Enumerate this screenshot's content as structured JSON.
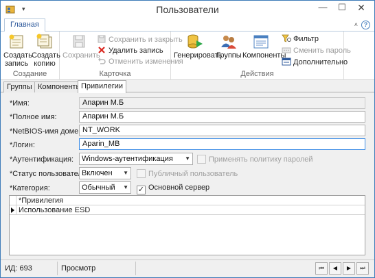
{
  "window": {
    "title": "Пользователи",
    "min_glyph": "—",
    "max_glyph": "☐",
    "close_glyph": "✕",
    "qat_glyph": "▾"
  },
  "ribbon": {
    "tab_label": "Главная",
    "collapse_glyph": "˄",
    "help_glyph": "?",
    "groups": {
      "create": {
        "label": "Создание",
        "create_record": "Создать запись",
        "create_copy": "Создать копию"
      },
      "card": {
        "label": "Карточка",
        "save": "Сохранить",
        "save_close": "Сохранить и закрыть",
        "delete": "Удалить запись",
        "cancel": "Отменить изменения"
      },
      "actions": {
        "label": "Действия",
        "generate": "Генерировать",
        "groups": "Группы",
        "components": "Компоненты",
        "filter": "Фильтр",
        "change_password": "Сменить пароль",
        "more": "Дополнительно"
      }
    }
  },
  "subtabs": [
    "Группы",
    "Компоненты",
    "Привилегии"
  ],
  "form": {
    "name_label": "*Имя:",
    "name_value": "Апарин М.Б",
    "fullname_label": "*Полное имя:",
    "fullname_value": "Апарин М.Б",
    "netbios_label": "*NetBIOS-имя домена:",
    "netbios_value": "NT_WORK",
    "login_label": "*Логин:",
    "login_value": "Aparin_MB",
    "auth_label": "*Аутентификация:",
    "auth_value": "Windows-аутентификация",
    "policy_label": "Применять политику паролей",
    "status_label": "*Статус пользователя:",
    "status_value": "Включен",
    "public_label": "Публичный пользователь",
    "category_label": "*Категория:",
    "category_value": "Обычный",
    "main_server_label": "Основной сервер",
    "check_glyph": "✓",
    "arrow_glyph": "▼"
  },
  "grid": {
    "header": "*Привилегия",
    "rows": [
      "Использование ESD"
    ]
  },
  "status": {
    "id": "ИД: 693",
    "mode": "Просмотр",
    "nav": [
      "⏮",
      "◀",
      "▶",
      "⏭"
    ]
  },
  "colors": {
    "accent": "#2b579a",
    "window_border": "#3c7ab8",
    "focus_border": "#3c8ce6",
    "delete_red": "#d9251d"
  }
}
